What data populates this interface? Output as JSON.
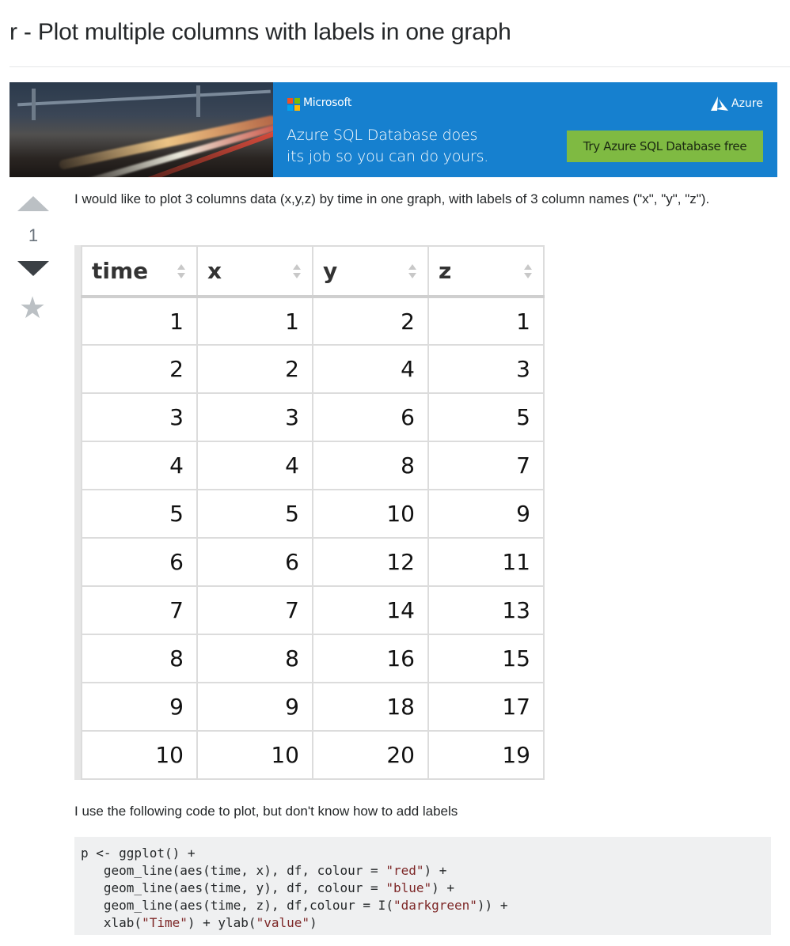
{
  "question": {
    "title": "r - Plot multiple columns with labels in one graph",
    "vote_count": "1",
    "body_intro": "I would like to plot 3 columns data (x,y,z) by time in one graph, with labels of 3 column names (\"x\", \"y\", \"z\").",
    "body_code_intro": "I use the following code to plot, but don't know how to add labels"
  },
  "ad": {
    "brand": "Microsoft",
    "headline_line1": "Azure SQL Database does",
    "headline_line2": "its job so you can do yours.",
    "product": "Azure",
    "cta": "Try Azure SQL Database free",
    "colors": {
      "background": "#1680cf",
      "cta": "#7fba42"
    }
  },
  "table": {
    "columns": [
      "time",
      "x",
      "y",
      "z"
    ],
    "rows": [
      [
        "1",
        "1",
        "2",
        "1"
      ],
      [
        "2",
        "2",
        "4",
        "3"
      ],
      [
        "3",
        "3",
        "6",
        "5"
      ],
      [
        "4",
        "4",
        "8",
        "7"
      ],
      [
        "5",
        "5",
        "10",
        "9"
      ],
      [
        "6",
        "6",
        "12",
        "11"
      ],
      [
        "7",
        "7",
        "14",
        "13"
      ],
      [
        "8",
        "8",
        "16",
        "15"
      ],
      [
        "9",
        "9",
        "18",
        "17"
      ],
      [
        "10",
        "10",
        "20",
        "19"
      ]
    ]
  },
  "code": {
    "lines": [
      "p <- ggplot() +",
      "   geom_line(aes(time, x), df, colour = \"red\") +",
      "   geom_line(aes(time, y), df, colour = \"blue\") +",
      "   geom_line(aes(time, z), df,colour = I(\"darkgreen\")) +",
      "   xlab(\"Time\") + ylab(\"value\")"
    ]
  },
  "icons": {
    "upvote": "upvote-arrow-icon",
    "downvote": "downvote-arrow-icon",
    "favorite": "star-icon",
    "sort": "sort-arrows-icon"
  }
}
